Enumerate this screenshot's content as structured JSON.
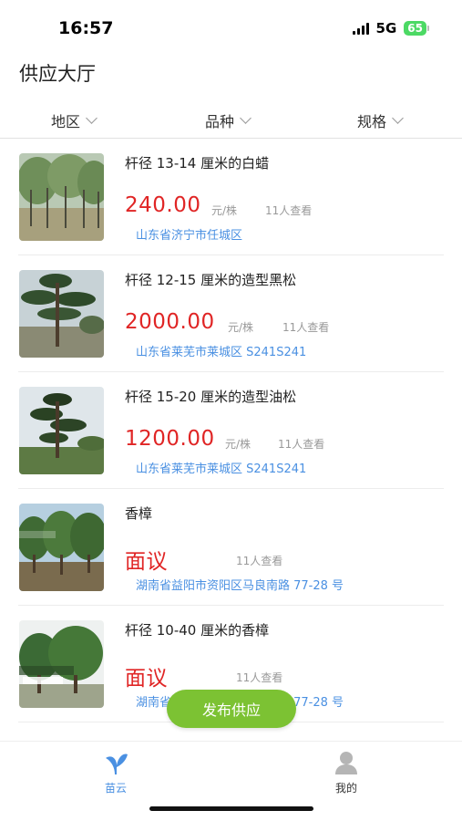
{
  "status_bar": {
    "time": "16:57",
    "network": "5G",
    "battery": "65"
  },
  "header": {
    "title": "供应大厅"
  },
  "filters": [
    {
      "label": "地区"
    },
    {
      "label": "品种"
    },
    {
      "label": "规格"
    }
  ],
  "listings": [
    {
      "title": "杆径 13-14 厘米的白蜡",
      "price": "240.00",
      "unit": "元/株",
      "views": "11人查看",
      "location": "山东省济宁市任城区",
      "image_icon": "ash-trees-photo"
    },
    {
      "title": "杆径 12-15 厘米的造型黑松",
      "price": "2000.00",
      "unit": "元/株",
      "views": "11人查看",
      "location": "山东省莱芜市莱城区 S241S241",
      "image_icon": "black-pine-photo"
    },
    {
      "title": "杆径 15-20 厘米的造型油松",
      "price": "1200.00",
      "unit": "元/株",
      "views": "11人查看",
      "location": "山东省莱芜市莱城区 S241S241",
      "image_icon": "chinese-pine-photo"
    },
    {
      "title": "香樟",
      "price": "面议",
      "unit": "",
      "views": "11人查看",
      "location": "湖南省益阳市资阳区马良南路 77-28 号",
      "image_icon": "camphor-trees-photo"
    },
    {
      "title": "杆径 10-40 厘米的香樟",
      "price": "面议",
      "unit": "",
      "views": "11人查看",
      "location": "湖南省益阳市资阳区马良南路 77-28 号",
      "image_icon": "camphor-tree-photo"
    }
  ],
  "publish_button": {
    "label": "发布供应"
  },
  "tab_bar": {
    "tabs": [
      {
        "label": "苗云",
        "icon": "sprout-icon",
        "active": true
      },
      {
        "label": "我的",
        "icon": "person-icon",
        "active": false
      }
    ]
  },
  "colors": {
    "price_red": "#e02525",
    "location_blue": "#4a90e2",
    "accent_green": "#7cc233",
    "tab_active": "#4a90e2",
    "tab_inactive": "#999999"
  }
}
